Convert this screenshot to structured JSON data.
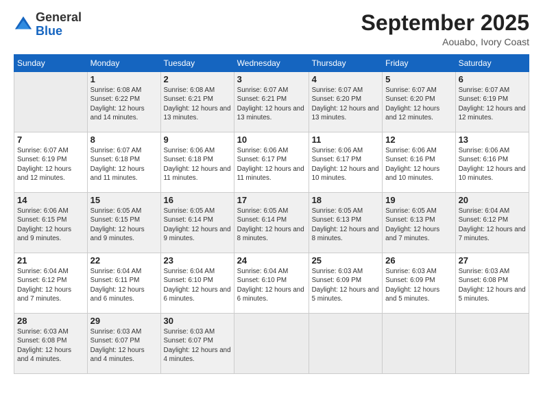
{
  "logo": {
    "general": "General",
    "blue": "Blue"
  },
  "header": {
    "month": "September 2025",
    "location": "Aouabo, Ivory Coast"
  },
  "weekdays": [
    "Sunday",
    "Monday",
    "Tuesday",
    "Wednesday",
    "Thursday",
    "Friday",
    "Saturday"
  ],
  "weeks": [
    [
      {
        "day": "",
        "detail": ""
      },
      {
        "day": "1",
        "detail": "Sunrise: 6:08 AM\nSunset: 6:22 PM\nDaylight: 12 hours\nand 14 minutes."
      },
      {
        "day": "2",
        "detail": "Sunrise: 6:08 AM\nSunset: 6:21 PM\nDaylight: 12 hours\nand 13 minutes."
      },
      {
        "day": "3",
        "detail": "Sunrise: 6:07 AM\nSunset: 6:21 PM\nDaylight: 12 hours\nand 13 minutes."
      },
      {
        "day": "4",
        "detail": "Sunrise: 6:07 AM\nSunset: 6:20 PM\nDaylight: 12 hours\nand 13 minutes."
      },
      {
        "day": "5",
        "detail": "Sunrise: 6:07 AM\nSunset: 6:20 PM\nDaylight: 12 hours\nand 12 minutes."
      },
      {
        "day": "6",
        "detail": "Sunrise: 6:07 AM\nSunset: 6:19 PM\nDaylight: 12 hours\nand 12 minutes."
      }
    ],
    [
      {
        "day": "7",
        "detail": ""
      },
      {
        "day": "8",
        "detail": "Sunrise: 6:07 AM\nSunset: 6:18 PM\nDaylight: 12 hours\nand 11 minutes."
      },
      {
        "day": "9",
        "detail": "Sunrise: 6:06 AM\nSunset: 6:18 PM\nDaylight: 12 hours\nand 11 minutes."
      },
      {
        "day": "10",
        "detail": "Sunrise: 6:06 AM\nSunset: 6:17 PM\nDaylight: 12 hours\nand 11 minutes."
      },
      {
        "day": "11",
        "detail": "Sunrise: 6:06 AM\nSunset: 6:17 PM\nDaylight: 12 hours\nand 10 minutes."
      },
      {
        "day": "12",
        "detail": "Sunrise: 6:06 AM\nSunset: 6:16 PM\nDaylight: 12 hours\nand 10 minutes."
      },
      {
        "day": "13",
        "detail": "Sunrise: 6:06 AM\nSunset: 6:16 PM\nDaylight: 12 hours\nand 10 minutes."
      }
    ],
    [
      {
        "day": "14",
        "detail": ""
      },
      {
        "day": "15",
        "detail": "Sunrise: 6:05 AM\nSunset: 6:15 PM\nDaylight: 12 hours\nand 9 minutes."
      },
      {
        "day": "16",
        "detail": "Sunrise: 6:05 AM\nSunset: 6:14 PM\nDaylight: 12 hours\nand 9 minutes."
      },
      {
        "day": "17",
        "detail": "Sunrise: 6:05 AM\nSunset: 6:14 PM\nDaylight: 12 hours\nand 8 minutes."
      },
      {
        "day": "18",
        "detail": "Sunrise: 6:05 AM\nSunset: 6:13 PM\nDaylight: 12 hours\nand 8 minutes."
      },
      {
        "day": "19",
        "detail": "Sunrise: 6:05 AM\nSunset: 6:13 PM\nDaylight: 12 hours\nand 7 minutes."
      },
      {
        "day": "20",
        "detail": "Sunrise: 6:04 AM\nSunset: 6:12 PM\nDaylight: 12 hours\nand 7 minutes."
      }
    ],
    [
      {
        "day": "21",
        "detail": ""
      },
      {
        "day": "22",
        "detail": "Sunrise: 6:04 AM\nSunset: 6:11 PM\nDaylight: 12 hours\nand 6 minutes."
      },
      {
        "day": "23",
        "detail": "Sunrise: 6:04 AM\nSunset: 6:10 PM\nDaylight: 12 hours\nand 6 minutes."
      },
      {
        "day": "24",
        "detail": "Sunrise: 6:04 AM\nSunset: 6:10 PM\nDaylight: 12 hours\nand 6 minutes."
      },
      {
        "day": "25",
        "detail": "Sunrise: 6:03 AM\nSunset: 6:09 PM\nDaylight: 12 hours\nand 5 minutes."
      },
      {
        "day": "26",
        "detail": "Sunrise: 6:03 AM\nSunset: 6:09 PM\nDaylight: 12 hours\nand 5 minutes."
      },
      {
        "day": "27",
        "detail": "Sunrise: 6:03 AM\nSunset: 6:08 PM\nDaylight: 12 hours\nand 5 minutes."
      }
    ],
    [
      {
        "day": "28",
        "detail": "Sunrise: 6:03 AM\nSunset: 6:08 PM\nDaylight: 12 hours\nand 4 minutes."
      },
      {
        "day": "29",
        "detail": "Sunrise: 6:03 AM\nSunset: 6:07 PM\nDaylight: 12 hours\nand 4 minutes."
      },
      {
        "day": "30",
        "detail": "Sunrise: 6:03 AM\nSunset: 6:07 PM\nDaylight: 12 hours\nand 4 minutes."
      },
      {
        "day": "",
        "detail": ""
      },
      {
        "day": "",
        "detail": ""
      },
      {
        "day": "",
        "detail": ""
      },
      {
        "day": "",
        "detail": ""
      }
    ]
  ],
  "week7_sundays": {
    "7": "Sunrise: 6:07 AM\nSunset: 6:19 PM\nDaylight: 12 hours\nand 12 minutes.",
    "14": "Sunrise: 6:06 AM\nSunset: 6:15 PM\nDaylight: 12 hours\nand 9 minutes.",
    "21": "Sunrise: 6:04 AM\nSunset: 6:12 PM\nDaylight: 12 hours\nand 7 minutes."
  }
}
